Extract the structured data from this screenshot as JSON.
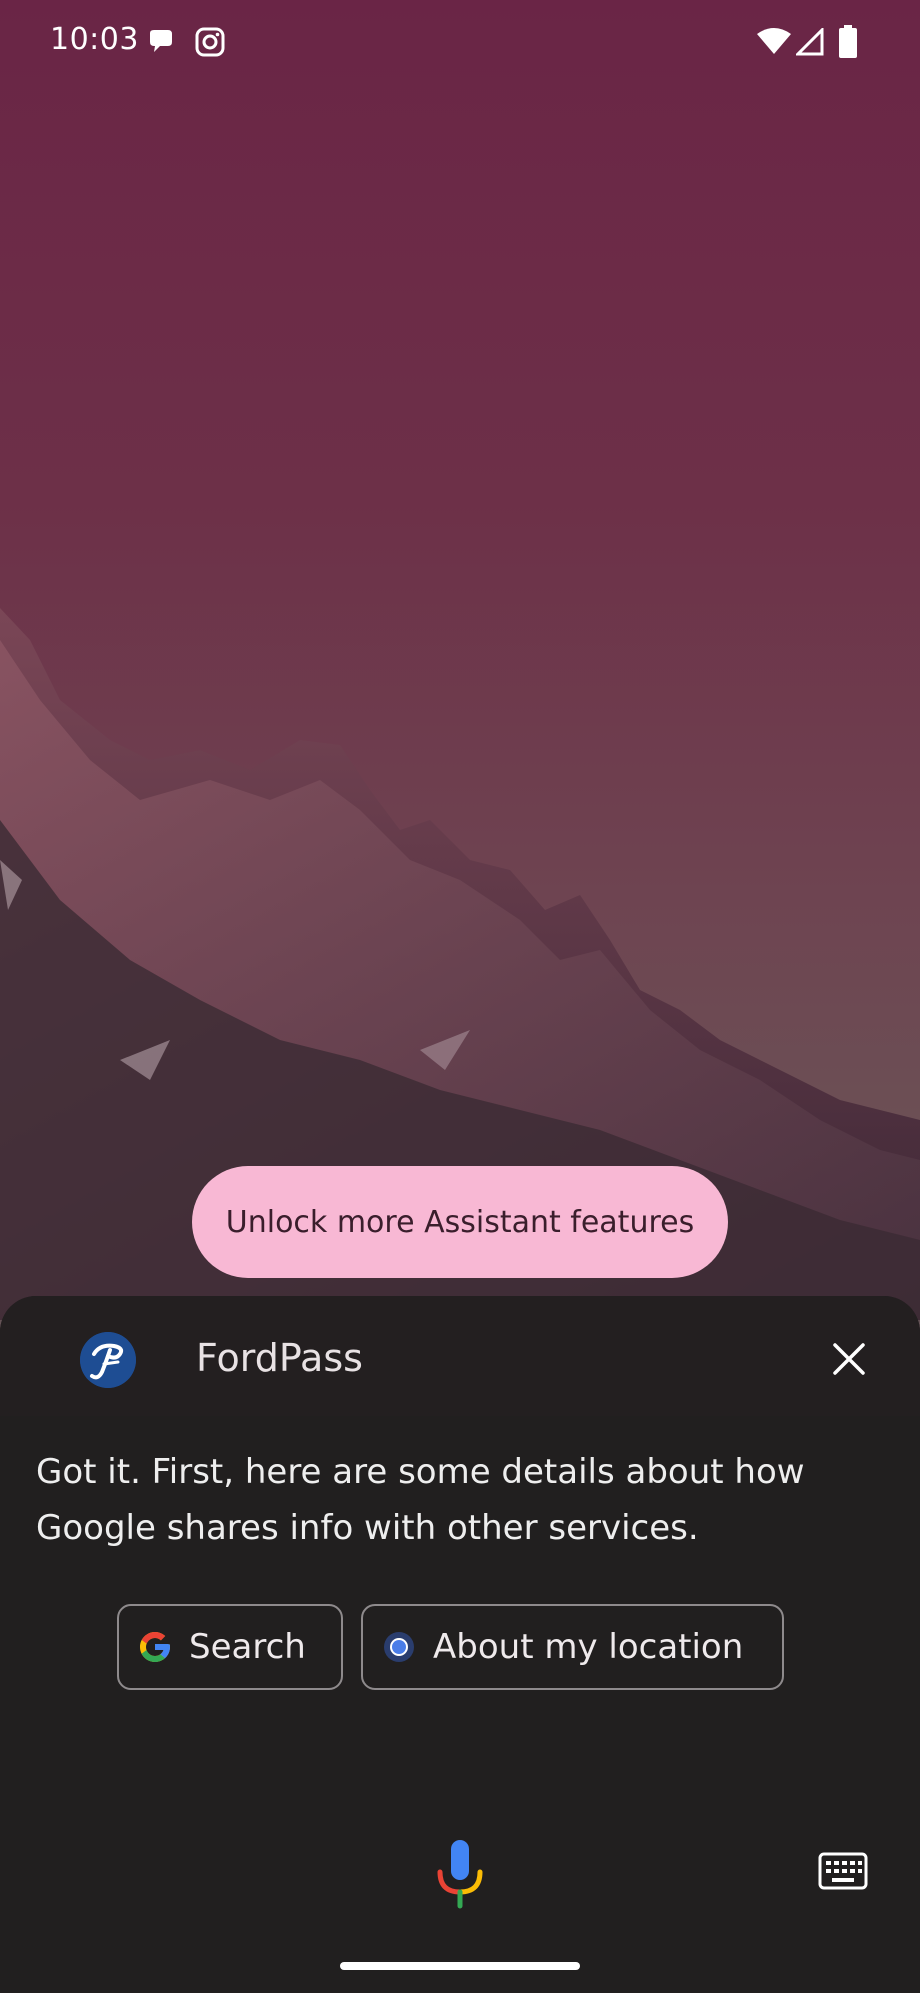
{
  "status_bar": {
    "time": "10:03",
    "left_icons": [
      "chat-bubble-icon",
      "instagram-icon"
    ],
    "right_icons": [
      "wifi-icon",
      "cell-signal-icon",
      "battery-icon"
    ]
  },
  "unlock_chip": {
    "label": "Unlock more Assistant features"
  },
  "assistant_sheet": {
    "app_name": "FordPass",
    "app_logo_icon": "fordpass-logo-icon",
    "close_icon": "close-icon",
    "response_text": "Got it. First, here are some details about how Google shares info with other services.",
    "suggestion_chips": [
      {
        "label": "Search",
        "icon": "google-g-icon"
      },
      {
        "label": "About my location",
        "icon": "location-dot-icon"
      }
    ],
    "mic_icon": "microphone-icon",
    "keyboard_icon": "keyboard-icon"
  },
  "colors": {
    "chip_background": "#f8b8d4",
    "sheet_background": "#211f1f",
    "google_blue": "#4285F4",
    "google_red": "#EA4335",
    "google_yellow": "#FBBC05",
    "google_green": "#34A853"
  }
}
